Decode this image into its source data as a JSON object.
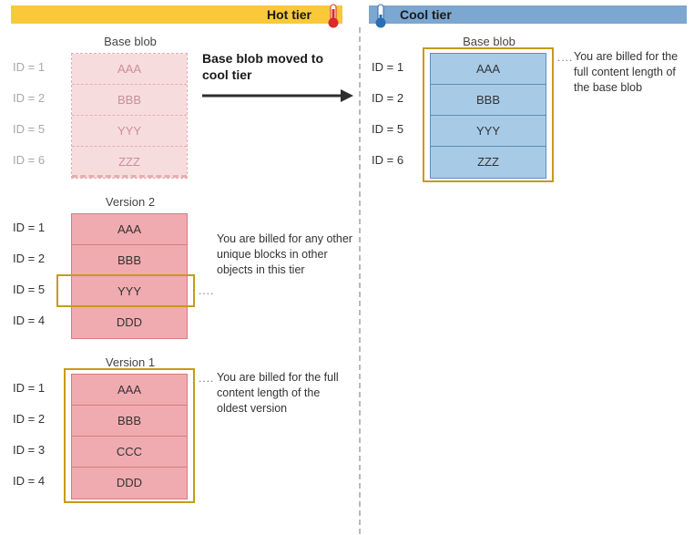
{
  "headers": {
    "hot": "Hot tier",
    "cool": "Cool tier"
  },
  "move_label": "Base blob moved to cool tier",
  "hot": {
    "base": {
      "title": "Base blob",
      "rows": [
        {
          "id": "ID = 1",
          "val": "AAA"
        },
        {
          "id": "ID = 2",
          "val": "BBB"
        },
        {
          "id": "ID = 5",
          "val": "YYY"
        },
        {
          "id": "ID = 6",
          "val": "ZZZ"
        }
      ]
    },
    "v2": {
      "title": "Version 2",
      "rows": [
        {
          "id": "ID = 1",
          "val": "AAA"
        },
        {
          "id": "ID = 2",
          "val": "BBB"
        },
        {
          "id": "ID = 5",
          "val": "YYY"
        },
        {
          "id": "ID = 4",
          "val": "DDD"
        }
      ]
    },
    "v1": {
      "title": "Version 1",
      "rows": [
        {
          "id": "ID = 1",
          "val": "AAA"
        },
        {
          "id": "ID = 2",
          "val": "BBB"
        },
        {
          "id": "ID = 3",
          "val": "CCC"
        },
        {
          "id": "ID = 4",
          "val": "DDD"
        }
      ]
    }
  },
  "cool": {
    "base": {
      "title": "Base blob",
      "rows": [
        {
          "id": "ID = 1",
          "val": "AAA"
        },
        {
          "id": "ID = 2",
          "val": "BBB"
        },
        {
          "id": "ID = 5",
          "val": "YYY"
        },
        {
          "id": "ID = 6",
          "val": "ZZZ"
        }
      ]
    }
  },
  "notes": {
    "cool_base": "You are billed for the full content length of the base blob",
    "v2": "You are billed for any other unique blocks in other objects in this tier",
    "v1": "You are billed for the full content length of the oldest version"
  },
  "dots": "...."
}
